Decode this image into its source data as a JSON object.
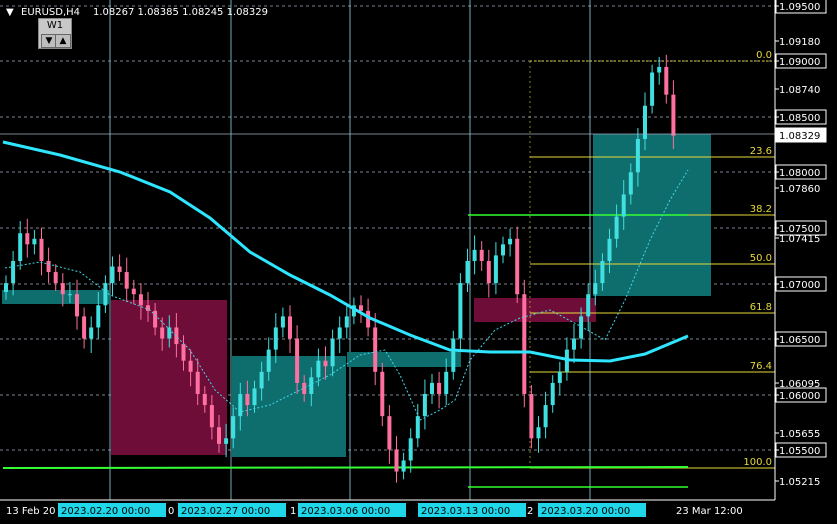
{
  "header": {
    "menu_arrow": "▼",
    "symbol": "EURUSD,H4",
    "ohlc": "1.08267 1.08385 1.08245 1.08329"
  },
  "timeframe_box": {
    "label": "W1",
    "down_arrow": "▼",
    "up_arrow": "▲"
  },
  "colors": {
    "background": "#000000",
    "grid": "#9fb0c0",
    "vertical_lines": "#8dd8e8",
    "bull_candle": "#40e0e0",
    "bear_candle": "#ff6f9f",
    "ma_line": "#2ee6ff",
    "fib_line": "#e6d83a",
    "support_line": "#33ff33",
    "box_dark_cyan": "#0e6e6e",
    "box_dark_magenta": "#6e0e38",
    "current_price": "#ffffff"
  },
  "price_axis": {
    "labels": [
      {
        "text": "1.09500",
        "boxed": true
      },
      {
        "text": "1.09180",
        "boxed": false
      },
      {
        "text": "1.09000",
        "boxed": true
      },
      {
        "text": "1.08740",
        "boxed": false
      },
      {
        "text": "1.08500",
        "boxed": true
      },
      {
        "text": "1.08329",
        "boxed": true,
        "current": true
      },
      {
        "text": "1.08000",
        "boxed": true
      },
      {
        "text": "1.07860",
        "boxed": false
      },
      {
        "text": "1.07500",
        "boxed": true
      },
      {
        "text": "1.07415",
        "boxed": false
      },
      {
        "text": "1.07000",
        "boxed": true
      },
      {
        "text": "1.06500",
        "boxed": true
      },
      {
        "text": "1.06095",
        "boxed": false
      },
      {
        "text": "1.06000",
        "boxed": true
      },
      {
        "text": "1.05655",
        "boxed": false
      },
      {
        "text": "1.05500",
        "boxed": true
      },
      {
        "text": "1.05215",
        "boxed": false
      }
    ]
  },
  "time_axis": {
    "labels": [
      {
        "text": "13 Feb 20",
        "highlight": false
      },
      {
        "text": "2023.02.20 00:00",
        "highlight": true
      },
      {
        "text": "2023.02.27 00:00",
        "highlight": true
      },
      {
        "text": "2023.03.06 00:00",
        "highlight": true
      },
      {
        "text": "2023.03.13 00:00",
        "highlight": true
      },
      {
        "text": "2023.03.20 00:00",
        "highlight": true
      },
      {
        "text": "23 Mar 12:00",
        "highlight": false
      }
    ],
    "partial_labels": [
      "0",
      "1",
      "2"
    ]
  },
  "fibonacci": {
    "levels": [
      {
        "text": "0.0",
        "value": 1.09
      },
      {
        "text": "23.6",
        "value": 1.0804
      },
      {
        "text": "38.2",
        "value": 1.0756
      },
      {
        "text": "50.0",
        "value": 1.0718
      },
      {
        "text": "61.8",
        "value": 1.068
      },
      {
        "text": "76.4",
        "value": 1.0625
      },
      {
        "text": "100.0",
        "value": 1.0535
      }
    ]
  },
  "chart_data": {
    "type": "candlestick",
    "symbol": "EURUSD",
    "timeframe": "H4",
    "ylim": [
      1.0513,
      1.095
    ],
    "current_price": 1.08329,
    "ohlc_last": [
      1.08267,
      1.08385,
      1.08245,
      1.08329
    ],
    "moving_average": [
      [
        0,
        1.0815
      ],
      [
        0.1,
        1.0806
      ],
      [
        0.16,
        1.0793
      ],
      [
        0.22,
        1.0772
      ],
      [
        0.3,
        1.0737
      ],
      [
        0.36,
        1.071
      ],
      [
        0.42,
        1.0688
      ],
      [
        0.48,
        1.0668
      ],
      [
        0.54,
        1.0656
      ],
      [
        0.6,
        1.0648
      ],
      [
        0.66,
        1.0646
      ],
      [
        0.72,
        1.0636
      ],
      [
        0.76,
        1.0631
      ],
      [
        0.8,
        1.0633
      ],
      [
        0.84,
        1.065
      ]
    ],
    "candle_closes": [
      1.07,
      1.072,
      1.0745,
      1.0735,
      1.074,
      1.072,
      1.071,
      1.07,
      1.069,
      1.069,
      1.067,
      1.065,
      1.066,
      1.068,
      1.07,
      1.0715,
      1.071,
      1.0695,
      1.069,
      1.068,
      1.0675,
      1.066,
      1.065,
      1.066,
      1.0645,
      1.063,
      1.062,
      1.06,
      1.059,
      1.057,
      1.0555,
      1.056,
      1.058,
      1.06,
      1.059,
      1.0605,
      1.062,
      1.064,
      1.066,
      1.067,
      1.065,
      1.061,
      1.06,
      1.0615,
      1.063,
      1.0625,
      1.065,
      1.066,
      1.067,
      1.068,
      1.0675,
      1.066,
      1.062,
      1.058,
      1.055,
      1.053,
      1.054,
      1.056,
      1.058,
      1.06,
      1.061,
      1.06,
      1.062,
      1.065,
      1.07,
      1.072,
      1.073,
      1.072,
      1.07,
      1.0725,
      1.0735,
      1.074,
      1.069,
      1.06,
      1.056,
      1.057,
      1.059,
      1.061,
      1.062,
      1.064,
      1.065,
      1.067,
      1.069,
      1.07,
      1.072,
      1.074,
      1.076,
      1.078,
      1.08,
      1.083,
      1.086,
      1.089,
      1.0895,
      1.087,
      1.0833
    ]
  }
}
